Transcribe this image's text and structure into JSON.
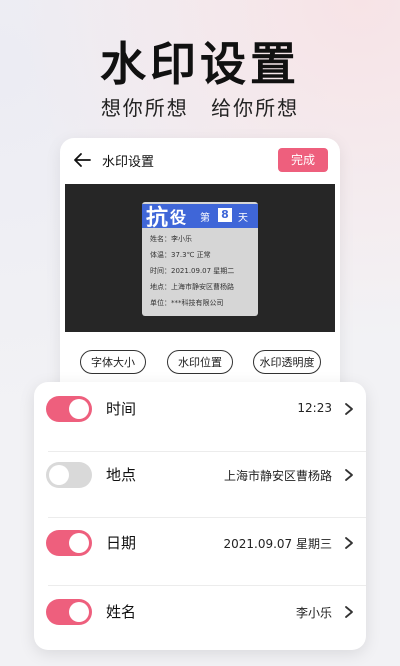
{
  "hero": {
    "title": "水印设置",
    "subtitle": "想你所想 给你所想"
  },
  "app": {
    "back_icon": "arrow-left-icon",
    "title": "水印设置",
    "done_label": "完成"
  },
  "watermark": {
    "badge_char1": "抗",
    "badge_char2": "役",
    "day_label": "第",
    "day_number": "8",
    "day_unit": "天",
    "lines": [
      "姓名：李小乐",
      "体温：37.3℃  正常",
      "时间：2021.09.07  星期二",
      "地点：上海市静安区曹杨路",
      "单位：***科技有限公司"
    ]
  },
  "chips": [
    "字体大小",
    "水印位置",
    "水印透明度"
  ],
  "settings": [
    {
      "label": "时间",
      "value": "12:23",
      "enabled": true
    },
    {
      "label": "地点",
      "value": "上海市静安区曹杨路",
      "enabled": false
    },
    {
      "label": "日期",
      "value": "2021.09.07 星期三",
      "enabled": true
    },
    {
      "label": "姓名",
      "value": "李小乐",
      "enabled": true
    }
  ],
  "colors": {
    "accent": "#ee5f7d",
    "badge_blue": "#3f66d8",
    "toggle_off": "#d9d9d9"
  }
}
